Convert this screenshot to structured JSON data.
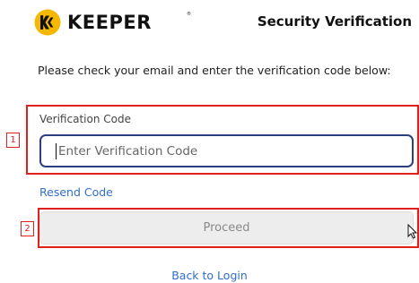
{
  "header": {
    "logo_text": "KEEPER",
    "logo_tm": "®",
    "title": "Security Verification"
  },
  "main": {
    "instructions": "Please check your email and enter the verification code below:",
    "verification": {
      "label": "Verification Code",
      "placeholder": "Enter Verification Code",
      "value": ""
    },
    "resend_label": "Resend Code",
    "proceed_label": "Proceed",
    "back_label": "Back to Login"
  },
  "annotations": [
    {
      "number": "1"
    },
    {
      "number": "2"
    }
  ],
  "colors": {
    "brand_yellow": "#f5b800",
    "link_blue": "#2f6fcf",
    "input_border": "#2b3f7d",
    "annotation_red": "#e0201e",
    "button_bg": "#ededed"
  },
  "icons": {
    "logo": "keeper-logo-icon",
    "cursor": "mouse-cursor-icon"
  }
}
